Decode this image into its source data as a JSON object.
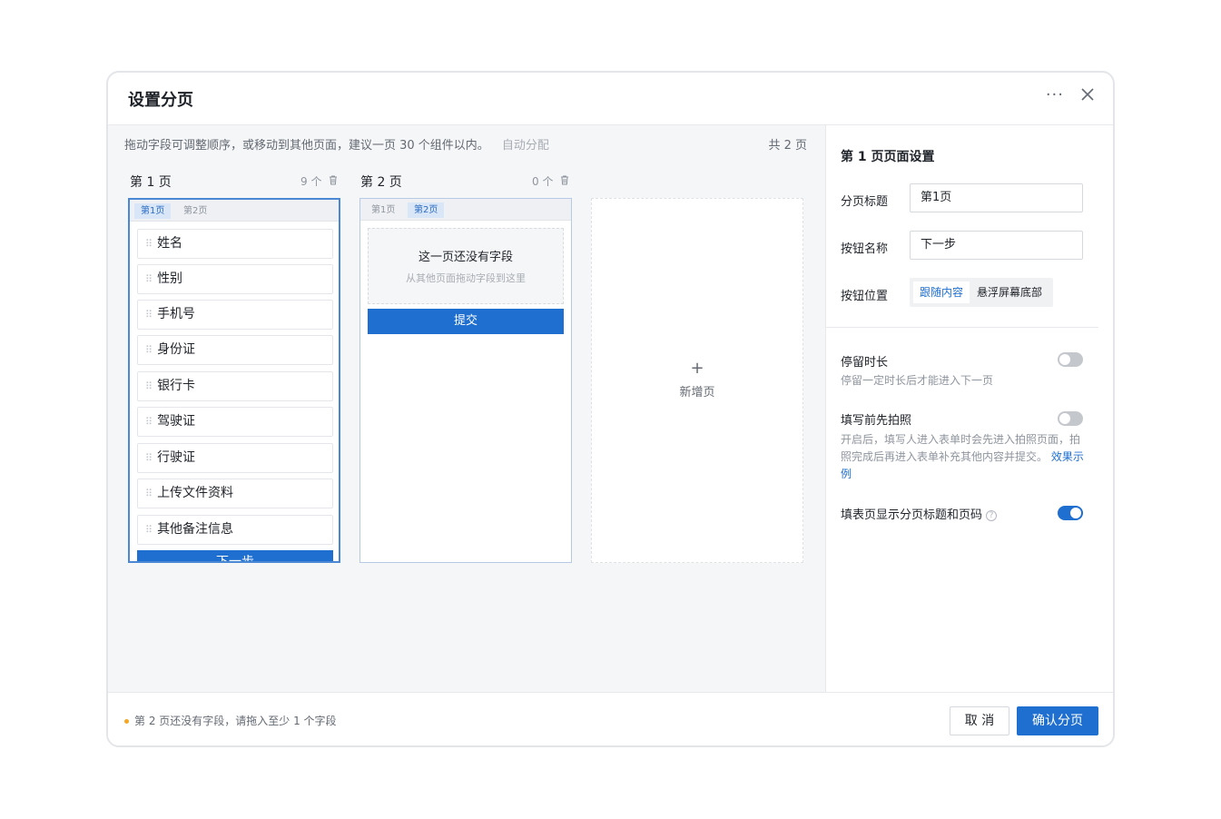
{
  "dialog": {
    "title": "设置分页",
    "more_icon": "more-icon",
    "close_icon": "close-icon"
  },
  "main": {
    "tip": "拖动字段可调整顺序，或移动到其他页面，建议一页 30 个组件以内。",
    "auto_assign": "自动分配",
    "total": "共 2 页"
  },
  "pages": [
    {
      "heading": "第 1 页",
      "count": "9 个",
      "tabs": [
        "第1页",
        "第2页"
      ],
      "fields": [
        "姓名",
        "性别",
        "手机号",
        "身份证",
        "银行卡",
        "驾驶证",
        "行驶证",
        "上传文件资料",
        "其他备注信息"
      ],
      "button": "下一步"
    },
    {
      "heading": "第 2 页",
      "count": "0 个",
      "tabs": [
        "第1页",
        "第2页"
      ],
      "empty_title": "这一页还没有字段",
      "empty_sub": "从其他页面拖动字段到这里",
      "button": "提交"
    }
  ],
  "add_page": {
    "plus": "+",
    "label": "新增页"
  },
  "settings": {
    "title": "第 1 页页面设置",
    "page_title_label": "分页标题",
    "page_title_value": "第1页",
    "button_name_label": "按钮名称",
    "button_name_value": "下一步",
    "button_position_label": "按钮位置",
    "position_options": [
      "跟随内容",
      "悬浮屏幕底部"
    ],
    "position_selected": "跟随内容",
    "stay_title": "停留时长",
    "stay_desc": "停留一定时长后才能进入下一页",
    "stay_enabled": false,
    "photo_title": "填写前先拍照",
    "photo_desc": "开启后，填写人进入表单时会先进入拍照页面，拍照完成后再进入表单补充其他内容并提交。",
    "photo_link": "效果示例",
    "photo_enabled": false,
    "show_title": "填表页显示分页标题和页码",
    "show_enabled": true
  },
  "footer": {
    "warning": "第 2 页还没有字段，请拖入至少 1 个字段",
    "cancel": "取 消",
    "confirm": "确认分页"
  },
  "colors": {
    "primary": "#1f6fd1",
    "warning": "#f5a623"
  }
}
